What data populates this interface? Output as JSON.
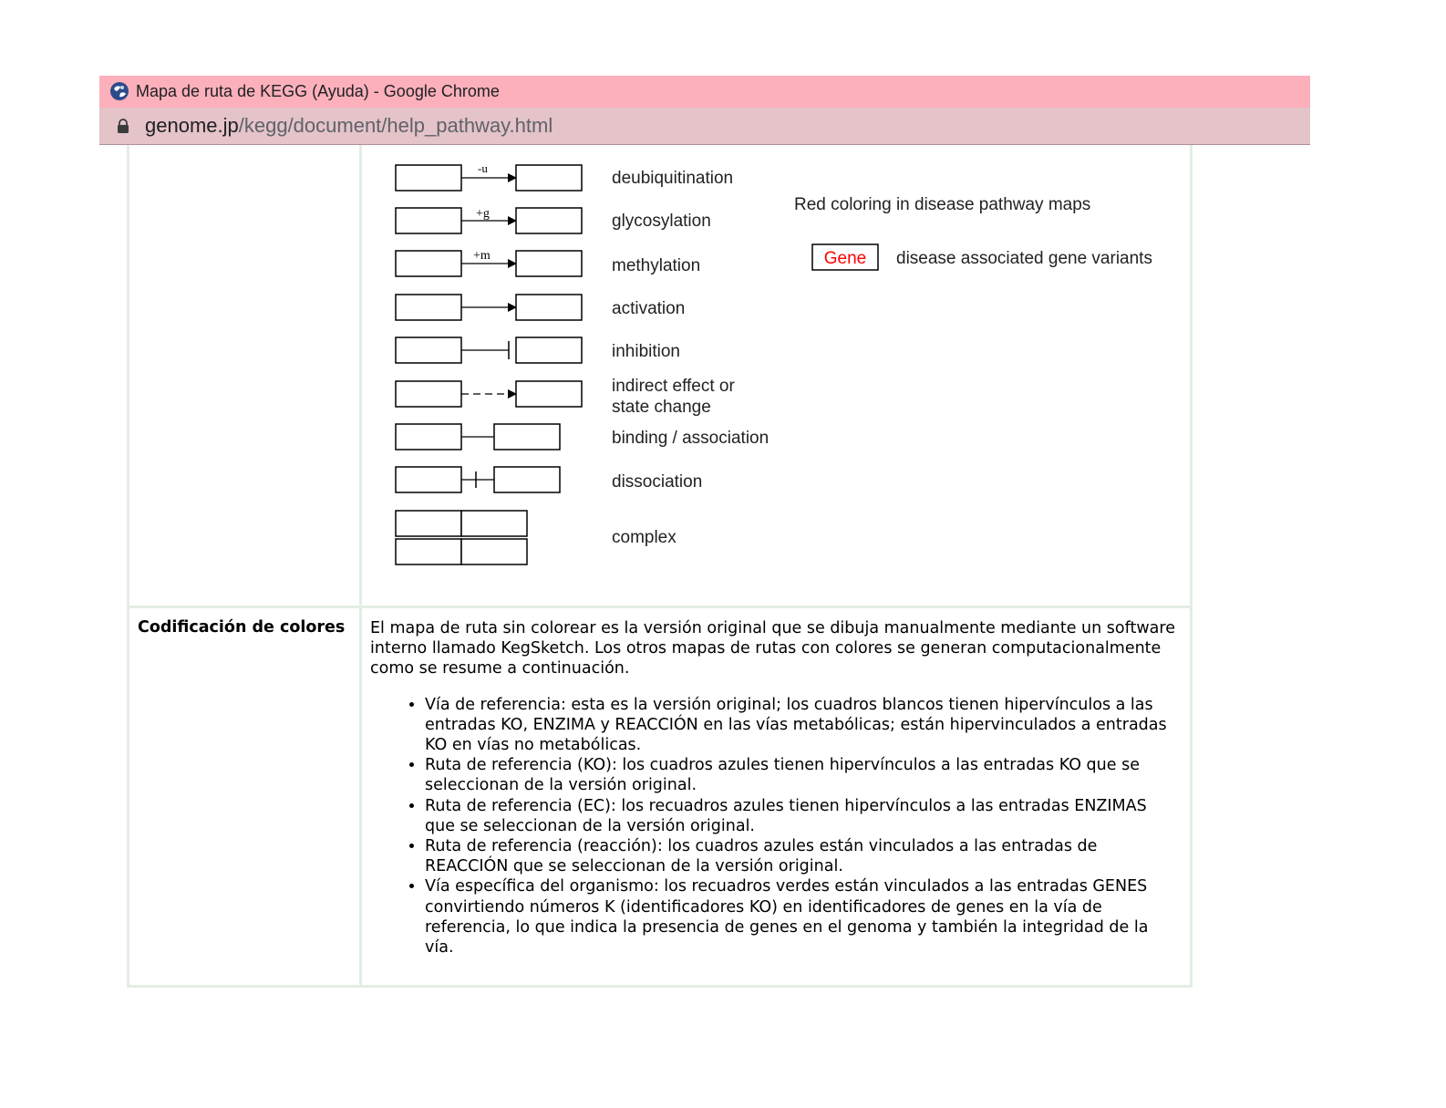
{
  "window": {
    "title": "Mapa de ruta de KEGG (Ayuda) - Google Chrome",
    "url_domain": "genome.jp",
    "url_path": "/kegg/document/help_pathway.html"
  },
  "legend": {
    "partial_top_label": "ubiquitination",
    "rows": [
      {
        "label": "deubiquitination",
        "arrow_text": "-u"
      },
      {
        "label": "glycosylation",
        "arrow_text": "+g"
      },
      {
        "label": "methylation",
        "arrow_text": "+m"
      },
      {
        "label": "activation"
      },
      {
        "label": "inhibition"
      },
      {
        "label_line1": "indirect effect or",
        "label_line2": "state change"
      },
      {
        "label": "binding / association"
      },
      {
        "label": "dissociation"
      },
      {
        "label": "complex"
      }
    ],
    "disease": {
      "title": "Red coloring in disease pathway maps",
      "gene_box": "Gene",
      "gene_label": "disease associated gene variants",
      "red_color": "#ff0000"
    }
  },
  "color_coding": {
    "heading": "Codificación de colores",
    "intro": "El mapa de ruta sin colorear es la versión original que se dibuja manualmente mediante un software interno llamado KegSketch. Los otros mapas de rutas con colores se generan computacionalmente como se resume a continuación.",
    "items": [
      "Vía de referencia: esta es la versión original; los cuadros blancos tienen hipervínculos a las entradas KO, ENZIMA y REACCIÓN en las vías metabólicas; están hipervinculados a entradas KO en vías no metabólicas.",
      "Ruta de referencia (KO): los cuadros azules tienen hipervínculos a las entradas KO que se seleccionan de la versión original.",
      "Ruta de referencia (EC): los recuadros azules tienen hipervínculos a las entradas ENZIMAS que se seleccionan de la versión original.",
      "Ruta de referencia (reacción): los cuadros azules están vinculados a las entradas de REACCIÓN que se seleccionan de la versión original.",
      "Vía específica del organismo: los recuadros verdes están vinculados a las entradas GENES convirtiendo números K (identificadores KO) en identificadores de genes en la vía de referencia, lo que indica la presencia de genes en el genoma y también la integridad de la vía."
    ]
  },
  "colors": {
    "titlebar_bg": "#fbb0bb",
    "addressbar_bg": "#e4c3c9",
    "table_border": "#e3eee3"
  }
}
